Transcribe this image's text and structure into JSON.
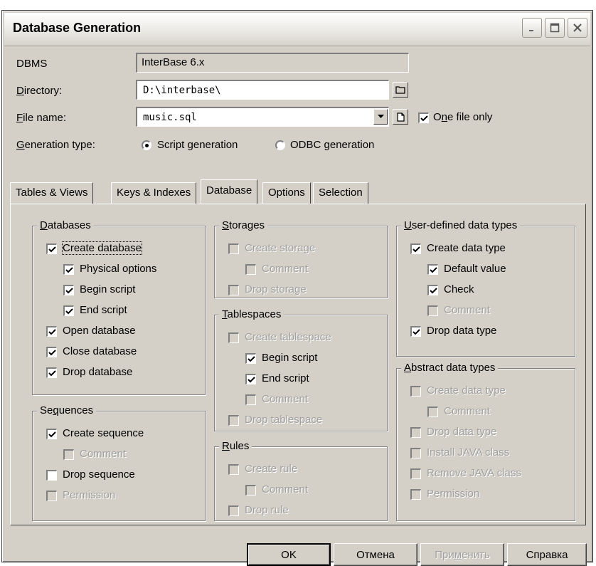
{
  "window": {
    "title": "Database Generation"
  },
  "form": {
    "dbms_label": "DBMS",
    "dbms_value": "InterBase 6.x",
    "directory_label_u": "D",
    "directory_label_rest": "irectory:",
    "directory_value": "D:\\interbase\\",
    "filename_label_u": "F",
    "filename_label_rest": "ile name:",
    "filename_value": "music.sql",
    "one_file_pre": "O",
    "one_file_u": "n",
    "one_file_rest": "e file only",
    "one_file_checked": true,
    "gentype_label_u": "G",
    "gentype_label_rest": "eneration type:",
    "script_generation": "Script generation",
    "odbc_generation": "ODBC generation",
    "selected_generation": "Script generation"
  },
  "tabs": [
    "Tables & Views",
    "Keys & Indexes",
    "Database",
    "Options",
    "Selection"
  ],
  "active_tab": "Database",
  "groups": {
    "databases": {
      "title_u": "D",
      "title_rest": "atabases",
      "items": [
        {
          "label": "Create database",
          "checked": true,
          "enabled": true
        },
        {
          "label": "Physical options",
          "checked": true,
          "enabled": true
        },
        {
          "label": "Begin script",
          "checked": true,
          "enabled": true
        },
        {
          "label": "End script",
          "checked": true,
          "enabled": true
        },
        {
          "label": "Open database",
          "checked": true,
          "enabled": true
        },
        {
          "label": "Close database",
          "checked": true,
          "enabled": true
        },
        {
          "label": "Drop database",
          "checked": true,
          "enabled": true
        }
      ]
    },
    "sequences": {
      "title_pre": "Se",
      "title_u": "q",
      "title_rest": "uences",
      "items": [
        {
          "label": "Create sequence",
          "checked": true,
          "enabled": true
        },
        {
          "label": "Comment",
          "checked": false,
          "enabled": false
        },
        {
          "label": "Drop sequence",
          "checked": false,
          "enabled": true
        },
        {
          "label": "Permission",
          "checked": false,
          "enabled": false
        }
      ]
    },
    "storages": {
      "title_u": "S",
      "title_rest": "torages",
      "items": [
        {
          "label": "Create storage",
          "checked": false,
          "enabled": false
        },
        {
          "label": "Comment",
          "checked": false,
          "enabled": false
        },
        {
          "label": "Drop storage",
          "checked": false,
          "enabled": false
        }
      ]
    },
    "tablespaces": {
      "title_u": "T",
      "title_rest": "ablespaces",
      "items": [
        {
          "label": "Create tablespace",
          "checked": false,
          "enabled": false
        },
        {
          "label": "Begin script",
          "checked": true,
          "enabled": true
        },
        {
          "label": "End script",
          "checked": true,
          "enabled": true
        },
        {
          "label": "Comment",
          "checked": false,
          "enabled": false
        },
        {
          "label": "Drop tablespace",
          "checked": false,
          "enabled": false
        }
      ]
    },
    "rules": {
      "title_u": "R",
      "title_rest": "ules",
      "items": [
        {
          "label": "Create rule",
          "checked": false,
          "enabled": false
        },
        {
          "label": "Comment",
          "checked": false,
          "enabled": false
        },
        {
          "label": "Drop rule",
          "checked": false,
          "enabled": false
        }
      ]
    },
    "udt": {
      "title_u": "U",
      "title_rest": "ser-defined data types",
      "items": [
        {
          "label": "Create data type",
          "checked": true,
          "enabled": true
        },
        {
          "label": "Default value",
          "checked": true,
          "enabled": true
        },
        {
          "label": "Check",
          "checked": true,
          "enabled": true
        },
        {
          "label": "Comment",
          "checked": false,
          "enabled": false
        },
        {
          "label": "Drop data type",
          "checked": true,
          "enabled": true
        }
      ]
    },
    "adt": {
      "title_u": "A",
      "title_rest": "bstract data types",
      "items": [
        {
          "label": "Create data type",
          "checked": false,
          "enabled": false
        },
        {
          "label": "Comment",
          "checked": false,
          "enabled": false
        },
        {
          "label": "Drop data type",
          "checked": false,
          "enabled": false
        },
        {
          "label": "Install JAVA class",
          "checked": false,
          "enabled": false
        },
        {
          "label": "Remove JAVA class",
          "checked": false,
          "enabled": false
        },
        {
          "label": "Permission",
          "checked": false,
          "enabled": false
        }
      ]
    }
  },
  "buttons": {
    "ok": "OK",
    "cancel": "Отмена",
    "apply_pre": "При",
    "apply_u": "м",
    "apply_rest": "енить",
    "help": "Справка"
  }
}
